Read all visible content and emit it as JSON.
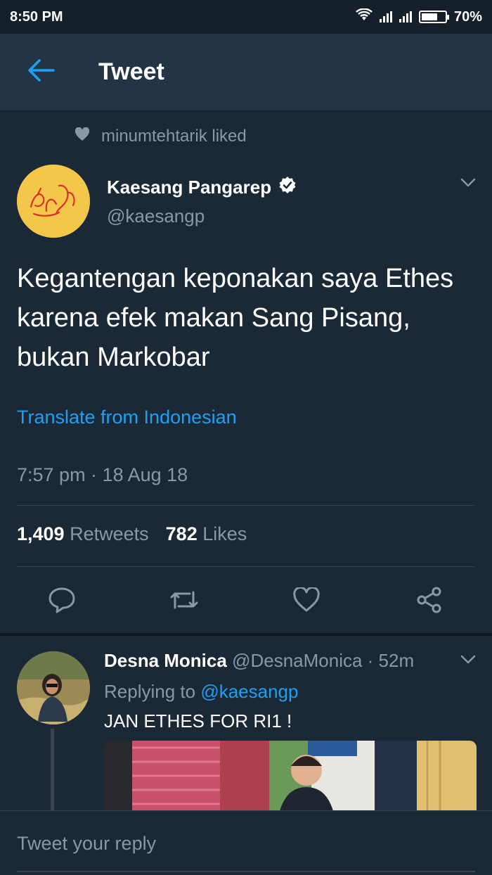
{
  "status_bar": {
    "time": "8:50 PM",
    "battery": "70%",
    "battery_level": 0.7
  },
  "header": {
    "title": "Tweet"
  },
  "context": {
    "liked_by": "minumtehtarik liked"
  },
  "tweet": {
    "author_name": "Kaesang Pangarep",
    "author_handle": "@kaesangp",
    "text": "Kegantengan keponakan saya Ethes karena efek makan Sang Pisang, bukan Markobar",
    "translate_label": "Translate from Indonesian",
    "timestamp": "7:57 pm · 18 Aug 18",
    "retweets_count": "1,409",
    "retweets_label": "Retweets",
    "likes_count": "782",
    "likes_label": "Likes"
  },
  "reply": {
    "author_name": "Desna Monica",
    "author_handle": "@DesnaMonica",
    "age": " · 52m",
    "replying_prefix": "Replying to ",
    "replying_to": "@kaesangp",
    "text": "JAN ETHES FOR RI1 !"
  },
  "composer": {
    "placeholder": "Tweet your reply"
  },
  "colors": {
    "accent": "#1da1f2",
    "background": "#1b2836",
    "header": "#243447",
    "muted": "#8899a6"
  },
  "icons": [
    "back-arrow-icon",
    "heart-icon",
    "verified-icon",
    "chevron-down-icon",
    "reply-icon",
    "retweet-icon",
    "like-icon",
    "share-icon",
    "wifi-icon",
    "signal-icon",
    "battery-icon"
  ]
}
